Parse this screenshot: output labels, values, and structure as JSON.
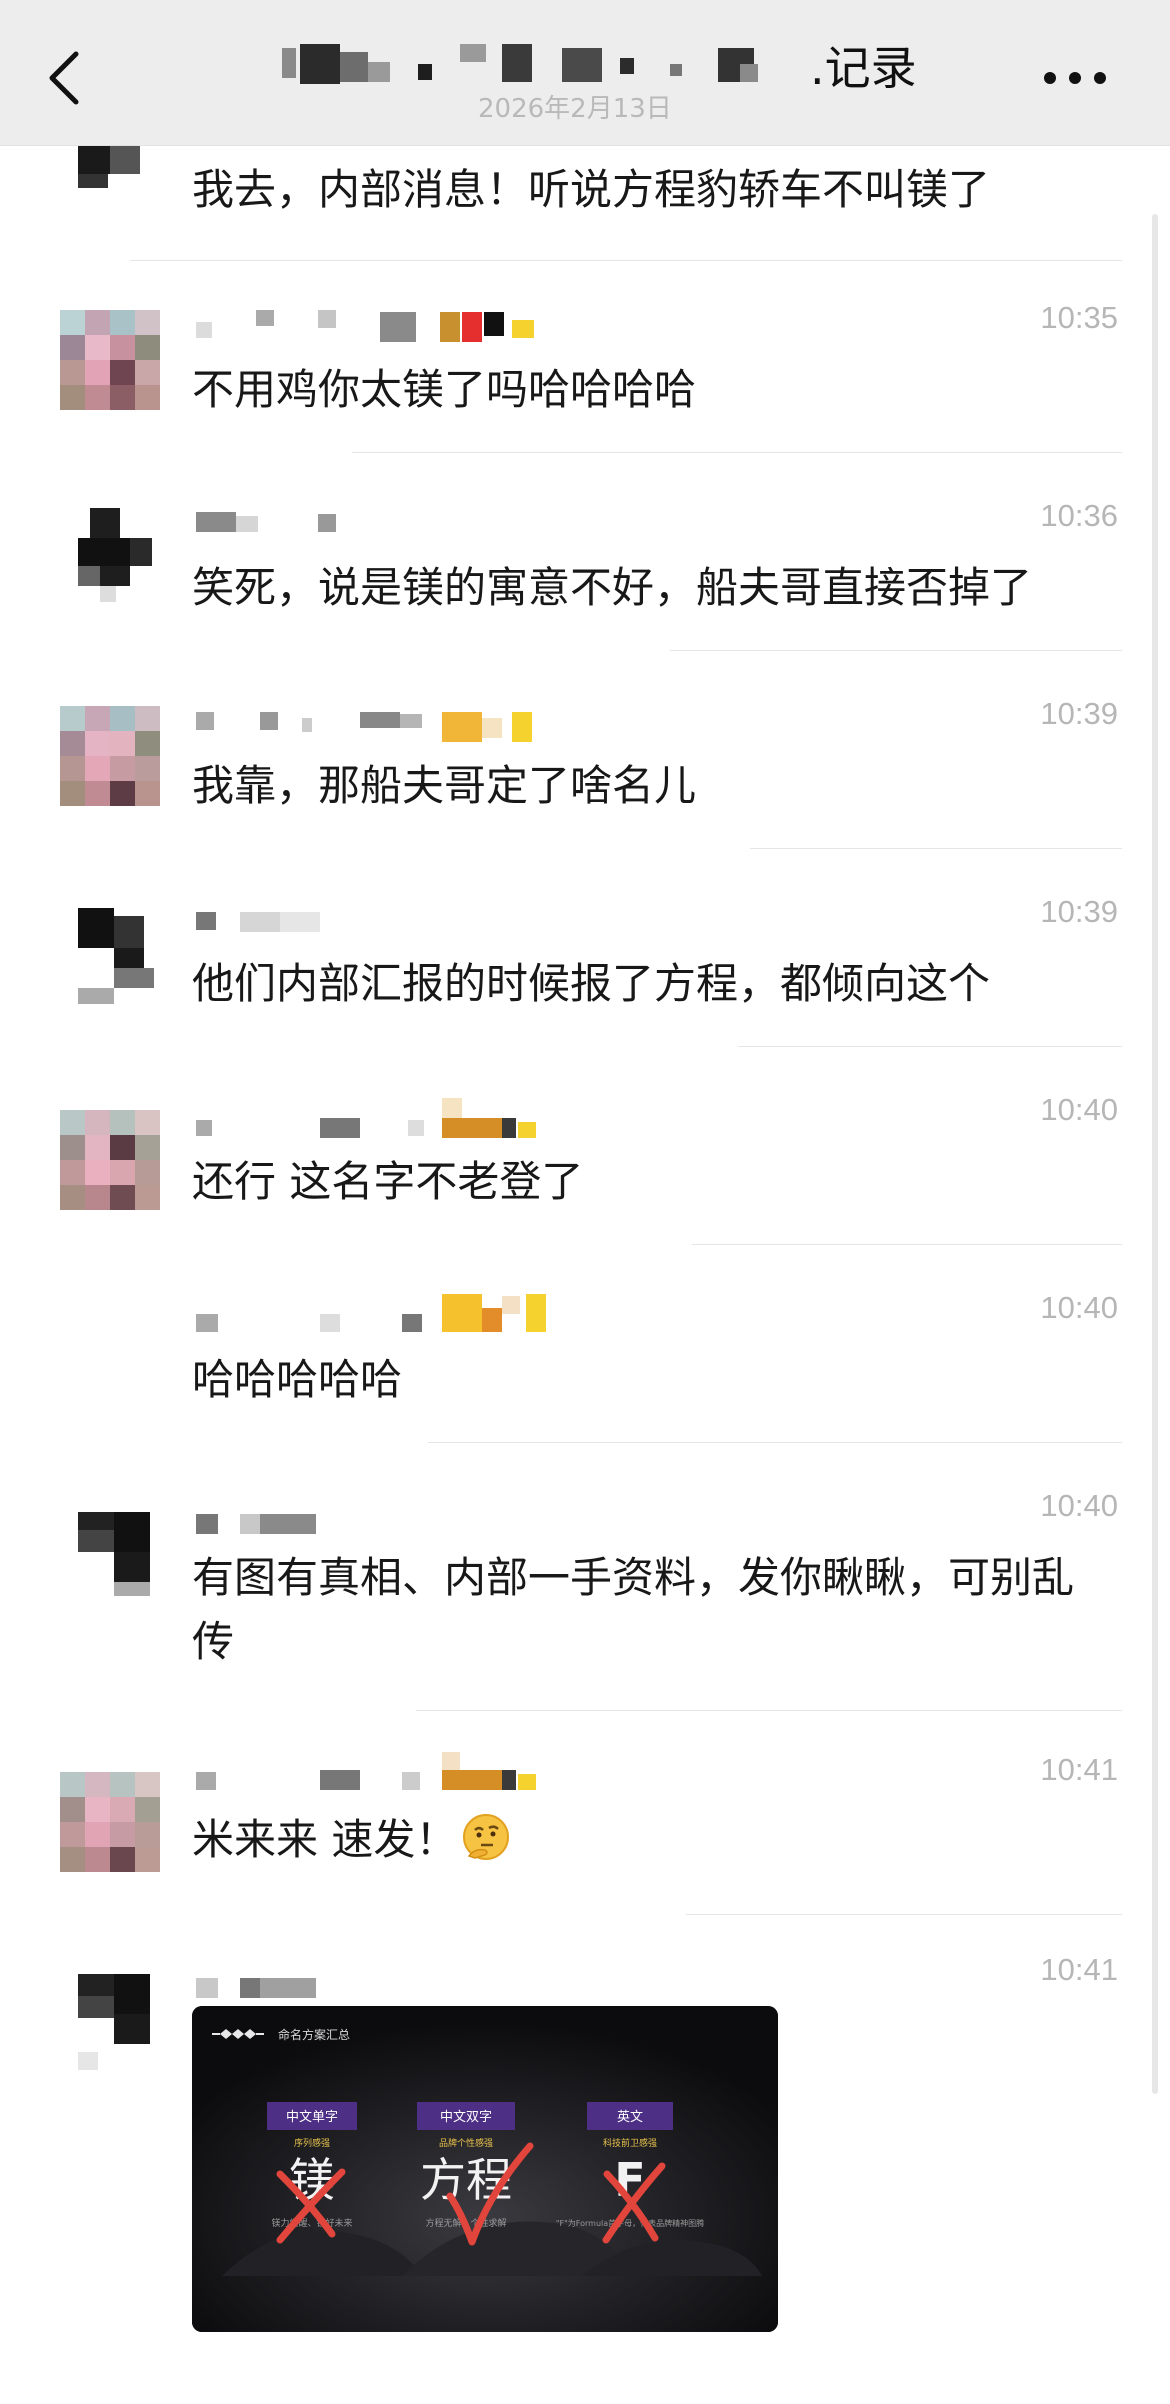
{
  "header": {
    "title": ".记录",
    "date": "2026年2月13日"
  },
  "messages": [
    {
      "time": "",
      "text": "我去，内部消息！听说方程豹轿车不叫镁了"
    },
    {
      "time": "10:35",
      "text": "不用鸡你太镁了吗哈哈哈哈"
    },
    {
      "time": "10:36",
      "text": "笑死，说是镁的寓意不好，船夫哥直接否掉了"
    },
    {
      "time": "10:39",
      "text": "我靠，那船夫哥定了啥名儿"
    },
    {
      "time": "10:39",
      "text": "他们内部汇报的时候报了方程，都倾向这个"
    },
    {
      "time": "10:40",
      "text": "还行 这名字不老登了"
    },
    {
      "time": "10:40",
      "text": "哈哈哈哈哈"
    },
    {
      "time": "10:40",
      "text": "有图有真相、内部一手资料，发你瞅瞅，可别乱传"
    },
    {
      "time": "10:41",
      "text": "米来来 速发！",
      "emoji": "thinking-face"
    },
    {
      "time": "10:41",
      "text": ""
    }
  ],
  "image_slide": {
    "heading": "命名方案汇总",
    "columns": [
      {
        "tag": "中文单字",
        "sub": "序列感强",
        "big": "镁",
        "desc": "镁力觉醒、镁好未来",
        "mark": "cross"
      },
      {
        "tag": "中文双字",
        "sub": "品牌个性感强",
        "big": "方程",
        "desc": "方程无解、个性求解",
        "mark": "check"
      },
      {
        "tag": "英文",
        "sub": "科技前卫感强",
        "big": "F",
        "desc": "\"F\"为Formula首字母，代表品牌精神图腾",
        "mark": "cross"
      }
    ]
  },
  "colors": {
    "header_bg": "#ededed",
    "time_text": "#b6b6b6",
    "divider": "#e6e6e6",
    "slide_tag_bg": "#4d2f86",
    "slide_sub_text": "#e8c24b",
    "mark_red": "#e2453c"
  }
}
